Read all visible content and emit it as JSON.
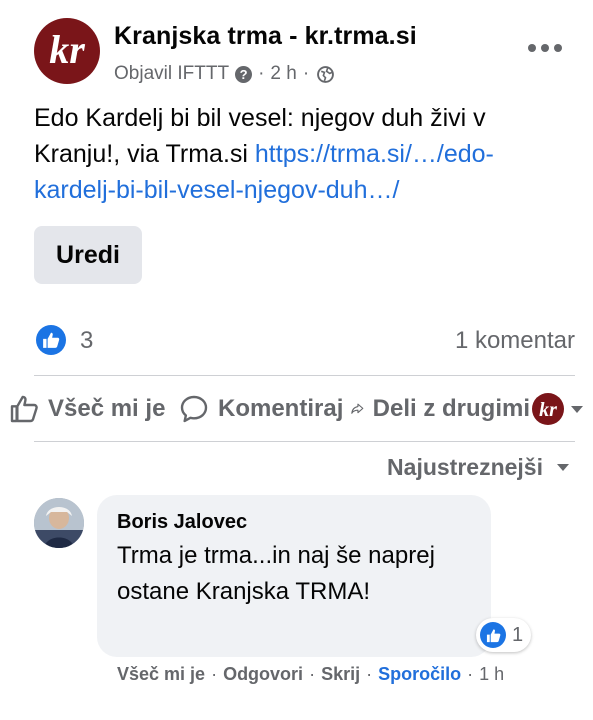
{
  "post": {
    "page_name": "Kranjska trma - kr.trma.si",
    "logo_text": "kr",
    "published_by": "Objavil IFTTT",
    "time": "2 h",
    "text": "Edo Kardelj bi bil vesel: njegov duh živi v Kranju!, via Trma.si ",
    "link": "https://trma.si/…/edo-kardelj-bi-bil-vesel-njegov-duh…/",
    "edit_label": "Uredi"
  },
  "stats": {
    "likes": "3",
    "comments": "1 komentar"
  },
  "actions": {
    "like": "Všeč mi je",
    "comment": "Komentiraj",
    "share": "Deli z drugimi"
  },
  "sort": {
    "label": "Najustreznejši"
  },
  "comment": {
    "author": "Boris Jalovec",
    "text": "Trma je trma...in naj še naprej ostane Kranjska TRMA!",
    "reactions": "1",
    "like": "Všeč mi je",
    "reply": "Odgovori",
    "hide": "Skrij",
    "report": "Sporočilo",
    "time": "1 h"
  },
  "colors": {
    "brand": "#7a1519",
    "link": "#216fdb",
    "like_blue": "#1b74e4"
  }
}
